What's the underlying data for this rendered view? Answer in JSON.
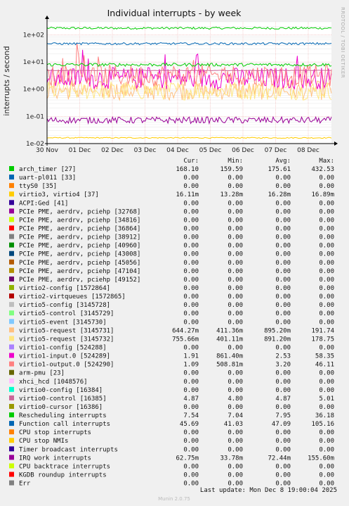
{
  "chart_data": {
    "type": "line",
    "title": "Individual interrupts - by week",
    "ylabel": "interrupts / second",
    "watermark": "RRDTOOL / TOBI OETIKER",
    "y_scale": "log",
    "ylim": [
      0.01,
      300
    ],
    "y_ticks": [
      {
        "value": 100,
        "label": "1e+02"
      },
      {
        "value": 10,
        "label": "1e+01"
      },
      {
        "value": 1,
        "label": "1e+00"
      },
      {
        "value": 0.1,
        "label": "1e-01"
      },
      {
        "value": 0.01,
        "label": "1e-02"
      }
    ],
    "x_ticks": [
      "30 Nov",
      "01 Dec",
      "02 Dec",
      "03 Dec",
      "04 Dec",
      "05 Dec",
      "06 Dec",
      "07 Dec",
      "08 Dec"
    ],
    "grid": true,
    "columns": [
      "Cur:",
      "Min:",
      "Avg:",
      "Max:"
    ],
    "series": [
      {
        "name": "arch_timer [27]",
        "color": "#00cc00",
        "cur": "168.10",
        "min": "159.59",
        "avg": "175.61",
        "max": "432.53",
        "level": 175.61
      },
      {
        "name": "uart-pl011 [33]",
        "color": "#0066b3",
        "cur": "0.00",
        "min": "0.00",
        "avg": "0.00",
        "max": "0.00",
        "level": 0
      },
      {
        "name": "ttyS0 [35]",
        "color": "#ff8000",
        "cur": "0.00",
        "min": "0.00",
        "avg": "0.00",
        "max": "0.00",
        "level": 0
      },
      {
        "name": "virtio3, virtio4 [37]",
        "color": "#ffcc00",
        "cur": "16.11m",
        "min": "13.28m",
        "avg": "16.28m",
        "max": "16.89m",
        "level": 0.01628
      },
      {
        "name": "ACPI:Ged [41]",
        "color": "#330099",
        "cur": "0.00",
        "min": "0.00",
        "avg": "0.00",
        "max": "0.00",
        "level": 0
      },
      {
        "name": "PCIe PME, aerdrv, pciehp [32768]",
        "color": "#990099",
        "cur": "0.00",
        "min": "0.00",
        "avg": "0.00",
        "max": "0.00",
        "level": 0
      },
      {
        "name": "PCIe PME, aerdrv, pciehp [34816]",
        "color": "#ccff00",
        "cur": "0.00",
        "min": "0.00",
        "avg": "0.00",
        "max": "0.00",
        "level": 0
      },
      {
        "name": "PCIe PME, aerdrv, pciehp [36864]",
        "color": "#ff0000",
        "cur": "0.00",
        "min": "0.00",
        "avg": "0.00",
        "max": "0.00",
        "level": 0
      },
      {
        "name": "PCIe PME, aerdrv, pciehp [38912]",
        "color": "#808080",
        "cur": "0.00",
        "min": "0.00",
        "avg": "0.00",
        "max": "0.00",
        "level": 0
      },
      {
        "name": "PCIe PME, aerdrv, pciehp [40960]",
        "color": "#008f00",
        "cur": "0.00",
        "min": "0.00",
        "avg": "0.00",
        "max": "0.00",
        "level": 0
      },
      {
        "name": "PCIe PME, aerdrv, pciehp [43008]",
        "color": "#00487d",
        "cur": "0.00",
        "min": "0.00",
        "avg": "0.00",
        "max": "0.00",
        "level": 0
      },
      {
        "name": "PCIe PME, aerdrv, pciehp [45056]",
        "color": "#b35a00",
        "cur": "0.00",
        "min": "0.00",
        "avg": "0.00",
        "max": "0.00",
        "level": 0
      },
      {
        "name": "PCIe PME, aerdrv, pciehp [47104]",
        "color": "#b38f00",
        "cur": "0.00",
        "min": "0.00",
        "avg": "0.00",
        "max": "0.00",
        "level": 0
      },
      {
        "name": "PCIe PME, aerdrv, pciehp [49152]",
        "color": "#6b006b",
        "cur": "0.00",
        "min": "0.00",
        "avg": "0.00",
        "max": "0.00",
        "level": 0
      },
      {
        "name": "virtio2-config [1572864]",
        "color": "#8fb300",
        "cur": "0.00",
        "min": "0.00",
        "avg": "0.00",
        "max": "0.00",
        "level": 0
      },
      {
        "name": "virtio2-virtqueues [1572865]",
        "color": "#b30000",
        "cur": "0.00",
        "min": "0.00",
        "avg": "0.00",
        "max": "0.00",
        "level": 0
      },
      {
        "name": "virtio5-config [3145728]",
        "color": "#bebebe",
        "cur": "0.00",
        "min": "0.00",
        "avg": "0.00",
        "max": "0.00",
        "level": 0
      },
      {
        "name": "virtio5-control [3145729]",
        "color": "#80ff80",
        "cur": "0.00",
        "min": "0.00",
        "avg": "0.00",
        "max": "0.00",
        "level": 0
      },
      {
        "name": "virtio5-event [3145730]",
        "color": "#80c9ff",
        "cur": "0.00",
        "min": "0.00",
        "avg": "0.00",
        "max": "0.00",
        "level": 0
      },
      {
        "name": "virtio5-request [3145731]",
        "color": "#ffc080",
        "cur": "644.27m",
        "min": "411.36m",
        "avg": "895.20m",
        "max": "191.74",
        "level": 0.8952
      },
      {
        "name": "virtio5-request [3145732]",
        "color": "#ffe680",
        "cur": "755.66m",
        "min": "401.11m",
        "avg": "891.20m",
        "max": "178.75",
        "level": 0.8912
      },
      {
        "name": "virtio1-config [524288]",
        "color": "#aa80ff",
        "cur": "0.00",
        "min": "0.00",
        "avg": "0.00",
        "max": "0.00",
        "level": 0
      },
      {
        "name": "virtio1-input.0 [524289]",
        "color": "#ee00cc",
        "cur": "1.91",
        "min": "861.40m",
        "avg": "2.53",
        "max": "58.35",
        "level": 2.53
      },
      {
        "name": "virtio1-output.0 [524290]",
        "color": "#ff8080",
        "cur": "1.09",
        "min": "508.81m",
        "avg": "3.20",
        "max": "46.11",
        "level": 3.2
      },
      {
        "name": "arm-pmu [23]",
        "color": "#666600",
        "cur": "0.00",
        "min": "0.00",
        "avg": "0.00",
        "max": "0.00",
        "level": 0
      },
      {
        "name": "xhci_hcd [1048576]",
        "color": "#ffbfff",
        "cur": "0.00",
        "min": "0.00",
        "avg": "0.00",
        "max": "0.00",
        "level": 0
      },
      {
        "name": "virtio0-config [16384]",
        "color": "#00ffcc",
        "cur": "0.00",
        "min": "0.00",
        "avg": "0.00",
        "max": "0.00",
        "level": 0
      },
      {
        "name": "virtio0-control [16385]",
        "color": "#cc6699",
        "cur": "4.87",
        "min": "4.80",
        "avg": "4.87",
        "max": "5.01",
        "level": 4.87
      },
      {
        "name": "virtio0-cursor [16386]",
        "color": "#999900",
        "cur": "0.00",
        "min": "0.00",
        "avg": "0.00",
        "max": "0.00",
        "level": 0
      },
      {
        "name": "Rescheduling interrupts",
        "color": "#00cc00",
        "cur": "7.54",
        "min": "7.04",
        "avg": "7.95",
        "max": "36.18",
        "level": 7.95
      },
      {
        "name": "Function call interrupts",
        "color": "#0066b3",
        "cur": "45.69",
        "min": "41.03",
        "avg": "47.09",
        "max": "105.16",
        "level": 47.09
      },
      {
        "name": "CPU stop interrupts",
        "color": "#ff8000",
        "cur": "0.00",
        "min": "0.00",
        "avg": "0.00",
        "max": "0.00",
        "level": 0
      },
      {
        "name": "CPU stop NMIs",
        "color": "#ffcc00",
        "cur": "0.00",
        "min": "0.00",
        "avg": "0.00",
        "max": "0.00",
        "level": 0
      },
      {
        "name": "Timer broadcast interrupts",
        "color": "#330099",
        "cur": "0.00",
        "min": "0.00",
        "avg": "0.00",
        "max": "0.00",
        "level": 0
      },
      {
        "name": "IRQ work interrupts",
        "color": "#990099",
        "cur": "62.75m",
        "min": "33.78m",
        "avg": "72.44m",
        "max": "155.60m",
        "level": 0.07244
      },
      {
        "name": "CPU backtrace interrupts",
        "color": "#ccff00",
        "cur": "0.00",
        "min": "0.00",
        "avg": "0.00",
        "max": "0.00",
        "level": 0
      },
      {
        "name": "KGDB roundup interrupts",
        "color": "#ff0000",
        "cur": "0.00",
        "min": "0.00",
        "avg": "0.00",
        "max": "0.00",
        "level": 0
      },
      {
        "name": "Err",
        "color": "#808080",
        "cur": "0.00",
        "min": "0.00",
        "avg": "0.00",
        "max": "0.00",
        "level": 0
      }
    ],
    "last_update": "Last update: Mon Dec  8 19:00:04 2025",
    "footer": "Munin 2.0.75"
  }
}
